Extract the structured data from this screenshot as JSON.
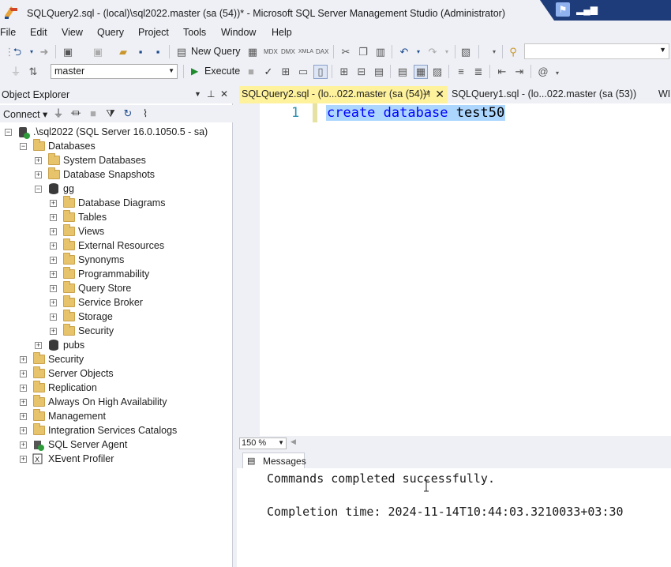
{
  "window": {
    "title": "SQLQuery2.sql - (local)\\sql2022.master (sa (54))* - Microsoft SQL Server Management Studio (Administrator)"
  },
  "menu": [
    "File",
    "Edit",
    "View",
    "Query",
    "Project",
    "Tools",
    "Window",
    "Help"
  ],
  "toolbar": {
    "new_query": "New Query",
    "database": "master",
    "execute": "Execute"
  },
  "object_explorer": {
    "title": "Object Explorer",
    "connect": "Connect",
    "server": ".\\sql2022 (SQL Server 16.0.1050.5 - sa)",
    "databases": "Databases",
    "system_databases": "System Databases",
    "database_snapshots": "Database Snapshots",
    "db_gg": "gg",
    "gg_children": [
      "Database Diagrams",
      "Tables",
      "Views",
      "External Resources",
      "Synonyms",
      "Programmability",
      "Query Store",
      "Service Broker",
      "Storage",
      "Security"
    ],
    "db_pubs": "pubs",
    "server_nodes": [
      "Security",
      "Server Objects",
      "Replication",
      "Always On High Availability",
      "Management",
      "Integration Services Catalogs"
    ],
    "sql_server_agent": "SQL Server Agent",
    "xevent_profiler": "XEvent Profiler"
  },
  "tabs": {
    "active": "SQLQuery2.sql - (lo...022.master (sa (54))*",
    "second": "SQLQuery1.sql - (lo...022.master (sa (53))",
    "third": "WI"
  },
  "editor": {
    "line_number": "1",
    "code_keyword": "create database",
    "code_name": "test50"
  },
  "zoom": "150 %",
  "results": {
    "tab_label": "Messages",
    "line1": "Commands completed successfully.",
    "line2": "Completion time: 2024-11-14T10:44:03.3210033+03:30"
  }
}
